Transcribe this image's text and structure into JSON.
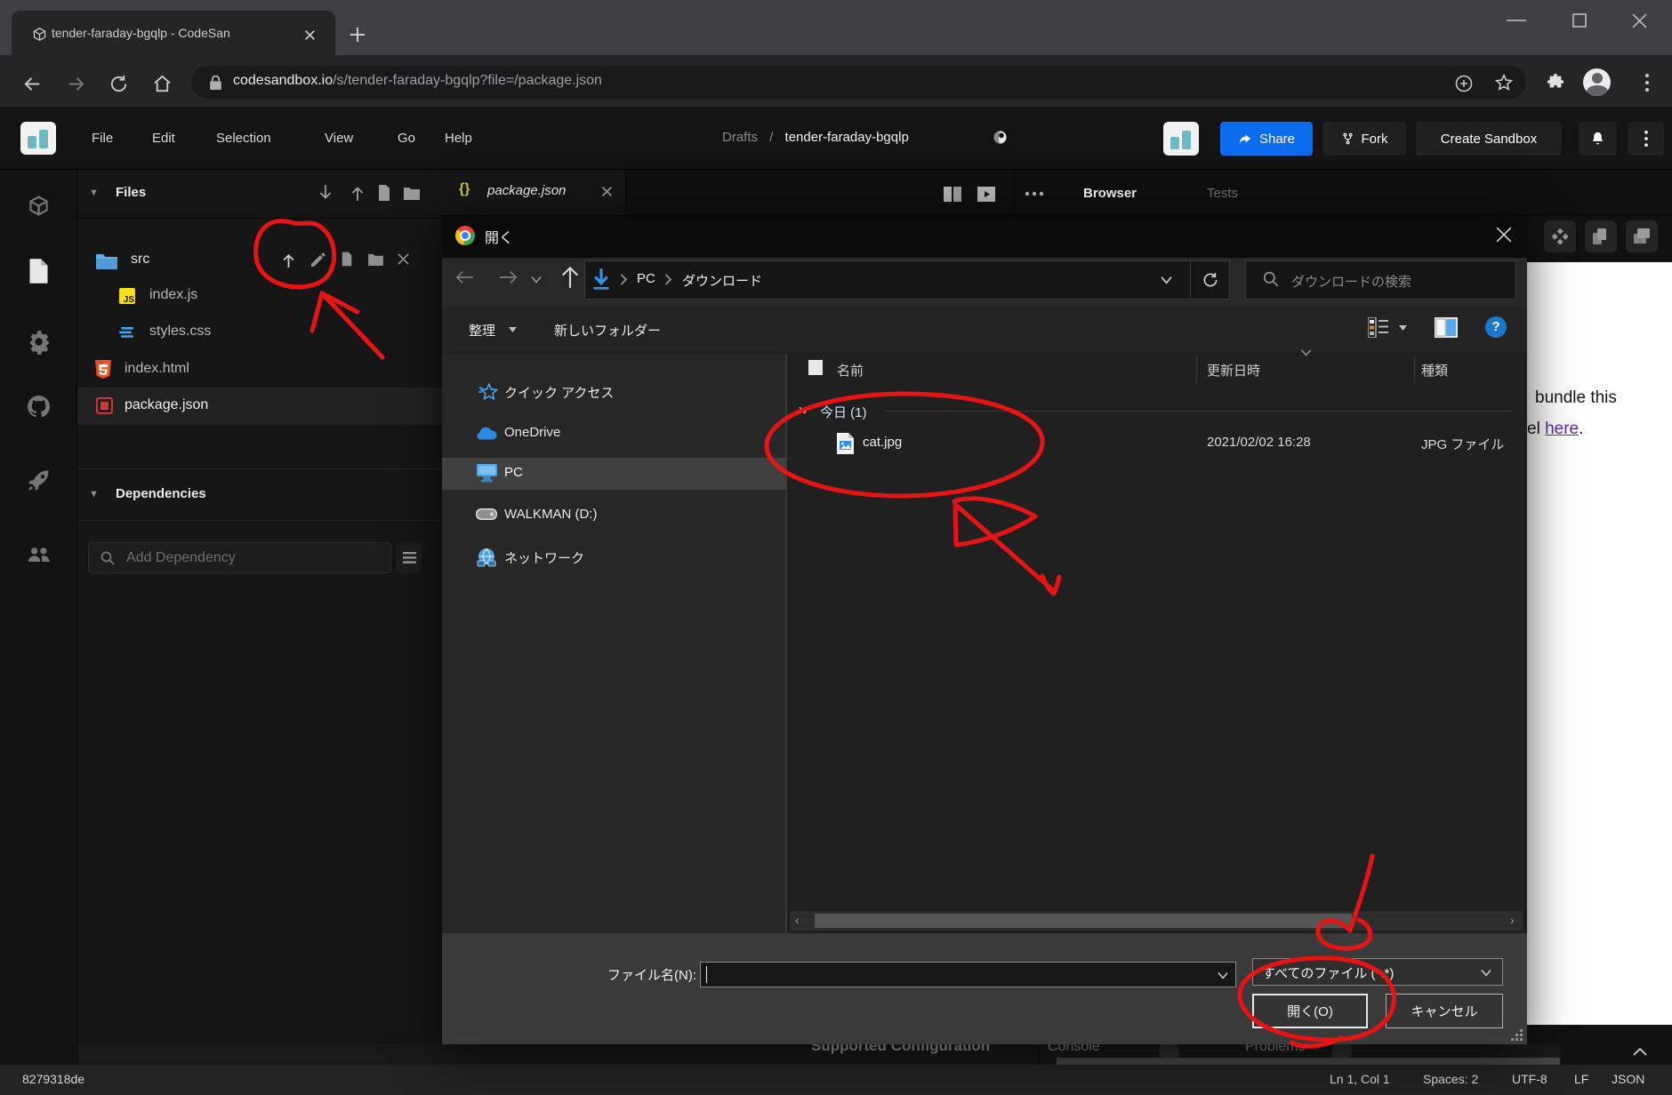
{
  "browser": {
    "tab_title": "tender-faraday-bgqlp - CodeSan",
    "url_host": "codesandbox.io",
    "url_path": "/s/tender-faraday-bgqlp?file=/package.json"
  },
  "csb_header": {
    "menus": [
      "File",
      "Edit",
      "Selection",
      "View",
      "Go",
      "Help"
    ],
    "breadcrumb": {
      "drafts": "Drafts",
      "separator": "/",
      "project_name": "tender-faraday-bgqlp"
    },
    "share_label": "Share",
    "fork_label": "Fork",
    "create_sandbox_label": "Create Sandbox"
  },
  "sidebar": {
    "files_header": "Files",
    "files": [
      {
        "name": "src",
        "type": "folder"
      },
      {
        "name": "index.js",
        "type": "javascript"
      },
      {
        "name": "styles.css",
        "type": "css"
      },
      {
        "name": "index.html",
        "type": "html"
      },
      {
        "name": "package.json",
        "type": "npm",
        "selected": true
      }
    ],
    "dependencies_header": "Dependencies",
    "add_dependency_placeholder": "Add Dependency"
  },
  "editor": {
    "tab_label": "package.json",
    "devtools_tabs": [
      {
        "label": "Browser",
        "active": true
      },
      {
        "label": "Tests",
        "active": false
      }
    ]
  },
  "dialog": {
    "title": "開く",
    "breadcrumb": {
      "root": "PC",
      "folder": "ダウンロード"
    },
    "search_placeholder": "ダウンロードの検索",
    "toolbar": {
      "organize": "整理",
      "new_folder": "新しいフォルダー"
    },
    "nav_items": [
      "クイック アクセス",
      "OneDrive",
      "PC",
      "WALKMAN (D:)",
      "ネットワーク"
    ],
    "columns": {
      "name": "名前",
      "modified": "更新日時",
      "type": "種類"
    },
    "group_label": "今日 (1)",
    "file": {
      "name": "cat.jpg",
      "modified": "2021/02/02 16:28",
      "type": "JPG ファイル"
    },
    "filename_label": "ファイル名(N):",
    "filetype_value": "すべてのファイル (*.*)",
    "open_label": "開く(O)",
    "cancel_label": "キャンセル"
  },
  "preview": {
    "line1": "bundle this",
    "line2_prefix": "el ",
    "link_text": "here",
    "line2_suffix": "."
  },
  "bottom_panel": {
    "section": "Supported Configuration",
    "console_label": "Console",
    "problems_label": "Problems"
  },
  "statusbar": {
    "commit": "8279318de",
    "cursor": "Ln 1, Col 1",
    "spaces": "Spaces: 2",
    "encoding": "UTF-8",
    "eol": "LF",
    "language": "JSON"
  },
  "colors": {
    "share_blue": "#0b6cf0",
    "annotation_red": "#e81313",
    "js_yellow": "#f7df1e",
    "html_orange": "#e44d26",
    "css_blue": "#42a5f5",
    "folder_blue": "#4f9cd8",
    "npm_red": "#cb3837",
    "link_purple": "#5e2ca5",
    "help_blue": "#1779c9"
  }
}
